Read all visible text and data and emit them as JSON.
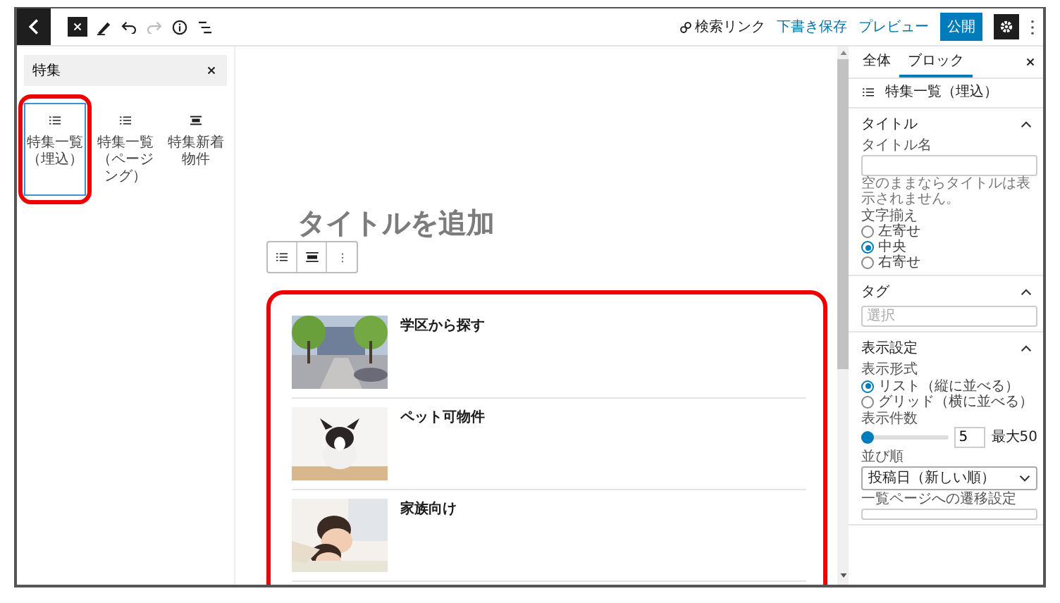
{
  "tools": [
    {
      "kind": "close"
    },
    {
      "kind": "pencil"
    },
    {
      "kind": "undo",
      "disabled": false
    },
    {
      "kind": "redo",
      "disabled": true
    },
    {
      "kind": "info"
    },
    {
      "kind": "outline"
    }
  ],
  "header_actions": {
    "search_link": "検索リンク",
    "save_draft": "下書き保存",
    "preview": "プレビュー",
    "publish": "公開",
    "settings_active": true
  },
  "inserter": {
    "highlighted": true,
    "search": {
      "value": "特集"
    },
    "blocks": [
      {
        "label": "特集一覧（埋込）",
        "kind": "list",
        "selected": true
      },
      {
        "label": "特集一覧（ページング）",
        "kind": "list",
        "selected": false
      },
      {
        "label": "特集新着物件",
        "kind": "feature",
        "selected": false
      }
    ]
  },
  "editor": {
    "title_placeholder": "タイトルを追加",
    "highlighted": true,
    "items": [
      {
        "kind": "entry",
        "title": "学区から探す"
      },
      {
        "kind": "entry",
        "title": "ペット可物件"
      },
      {
        "kind": "entry",
        "title": "家族向け"
      },
      {
        "kind": "partial"
      }
    ]
  },
  "sidebar": {
    "tabs": [
      {
        "label": "全体",
        "selected": false
      },
      {
        "label": "ブロック",
        "selected": true
      }
    ],
    "block_name": "特集一覧（埋込）",
    "title_panel": {
      "heading": "タイトル",
      "expanded": true,
      "field_label": "タイトル名",
      "hint": "空のままならタイトルは表示されません。",
      "align_label": "文字揃え",
      "align_options": [
        {
          "label": "左寄せ",
          "selected": false
        },
        {
          "label": "中央",
          "selected": true
        },
        {
          "label": "右寄せ",
          "selected": false
        }
      ]
    },
    "tag_panel": {
      "heading": "タグ",
      "expanded": true,
      "placeholder": "選択"
    },
    "display_panel": {
      "heading": "表示設定",
      "expanded": true,
      "format_label": "表示形式",
      "format_options": [
        {
          "label": "リスト（縦に並べる）",
          "selected": true
        },
        {
          "label": "グリッド（横に並べる）",
          "selected": false
        }
      ],
      "count_label": "表示件数",
      "count": {
        "level": 0.04,
        "value": "5",
        "max_label": "最大50"
      },
      "order_label": "並び順",
      "order_value": "投稿日（新しい順）",
      "link_label": "一覧ページへの遷移設定"
    }
  }
}
